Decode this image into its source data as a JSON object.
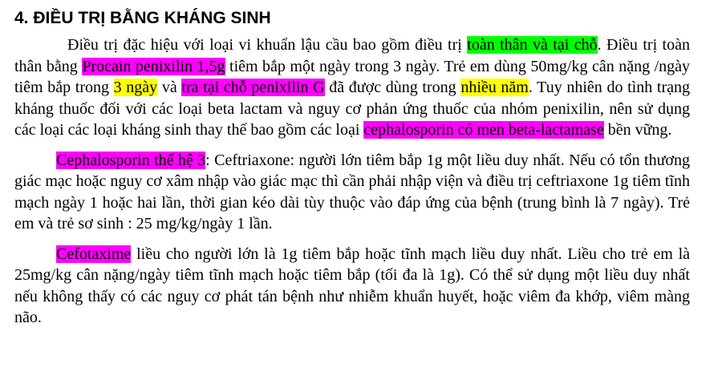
{
  "colors": {
    "highlight_green": "#00ff00",
    "highlight_magenta": "#ff00ff",
    "highlight_yellow": "#ffff00"
  },
  "section": {
    "heading": "4. ĐIỀU TRỊ BẰNG KHÁNG SINH",
    "p1": {
      "s1": "Điều trị đặc hiệu với loại vi khuẩn lậu cầu bao gồm điều trị ",
      "h1": "toàn thân và tại chỗ",
      "s2": ". Điều trị toàn thân bằng ",
      "h2": "Procain penixilin 1,5g",
      "s3": " tiêm bắp một ngày trong 3 ngày. Trẻ em dùng 50mg/kg cân nặng /ngày tiêm bắp trong ",
      "h3": "3 ngày",
      "s4": " và ",
      "h4": "tra tại chỗ penixilin G",
      "s5": " đã được dùng trong ",
      "h5": "nhiều năm",
      "s6": ". Tuy nhiên do tình trạng kháng thuốc đối với các loại beta lactam và nguy cơ phản ứng thuốc của nhóm penixilin, nên sử dụng các loại các loại kháng sinh thay thế bao gồm các loại ",
      "h6": "cephalosporin có men beta-lactamase",
      "s7": " bền vững."
    },
    "p2": {
      "h1": "Cephalosporin thế hệ 3",
      "s1": ": Ceftriaxone: người lớn tiêm bắp 1g một liều duy nhất. Nếu có tổn thương giác mạc hoặc nguy cơ xâm nhập vào giác mạc thì cần phải nhập viện và điều trị ceftriaxone 1g tiêm tĩnh mạch ngày 1 hoặc hai lần, thời gian kéo dài tùy thuộc vào đáp ứng của bệnh (trung bình là 7 ngày). Trẻ em và trẻ sơ sinh : 25 mg/kg/ngày 1 lần."
    },
    "p3": {
      "h1": "Cefotaxime",
      "s1": " liều cho người lớn là 1g tiêm bắp hoặc tĩnh mạch liều duy nhất. Liều cho trẻ em là 25mg/kg cân nặng/ngày tiêm tĩnh mạch hoặc tiêm bắp (tối đa là 1g). Có thể sử dụng một liều duy nhất nếu không thấy có các nguy cơ phát tán bệnh như nhiễm khuẩn huyết, hoặc viêm đa khớp, viêm màng não."
    }
  }
}
